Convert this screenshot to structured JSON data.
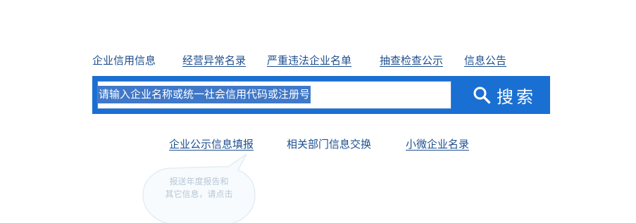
{
  "nav": {
    "tabs": [
      {
        "label": "企业信用信息"
      },
      {
        "label": "经营异常名录"
      },
      {
        "label": "严重违法企业名单"
      },
      {
        "label": "抽查检查公示"
      },
      {
        "label": "信息公告"
      }
    ]
  },
  "search": {
    "placeholder": "请输入企业名称或统一社会信用代码或注册号",
    "button_label": "搜索",
    "icon": "search-icon"
  },
  "links": [
    {
      "label": "企业公示信息填报"
    },
    {
      "label": "相关部门信息交换"
    },
    {
      "label": "小微企业名录"
    }
  ],
  "bubble": {
    "line1": "报送年度报告和",
    "line2": "其它信息，请点击"
  },
  "colors": {
    "accent": "#1a6fd2",
    "link": "#1d4f8f"
  }
}
